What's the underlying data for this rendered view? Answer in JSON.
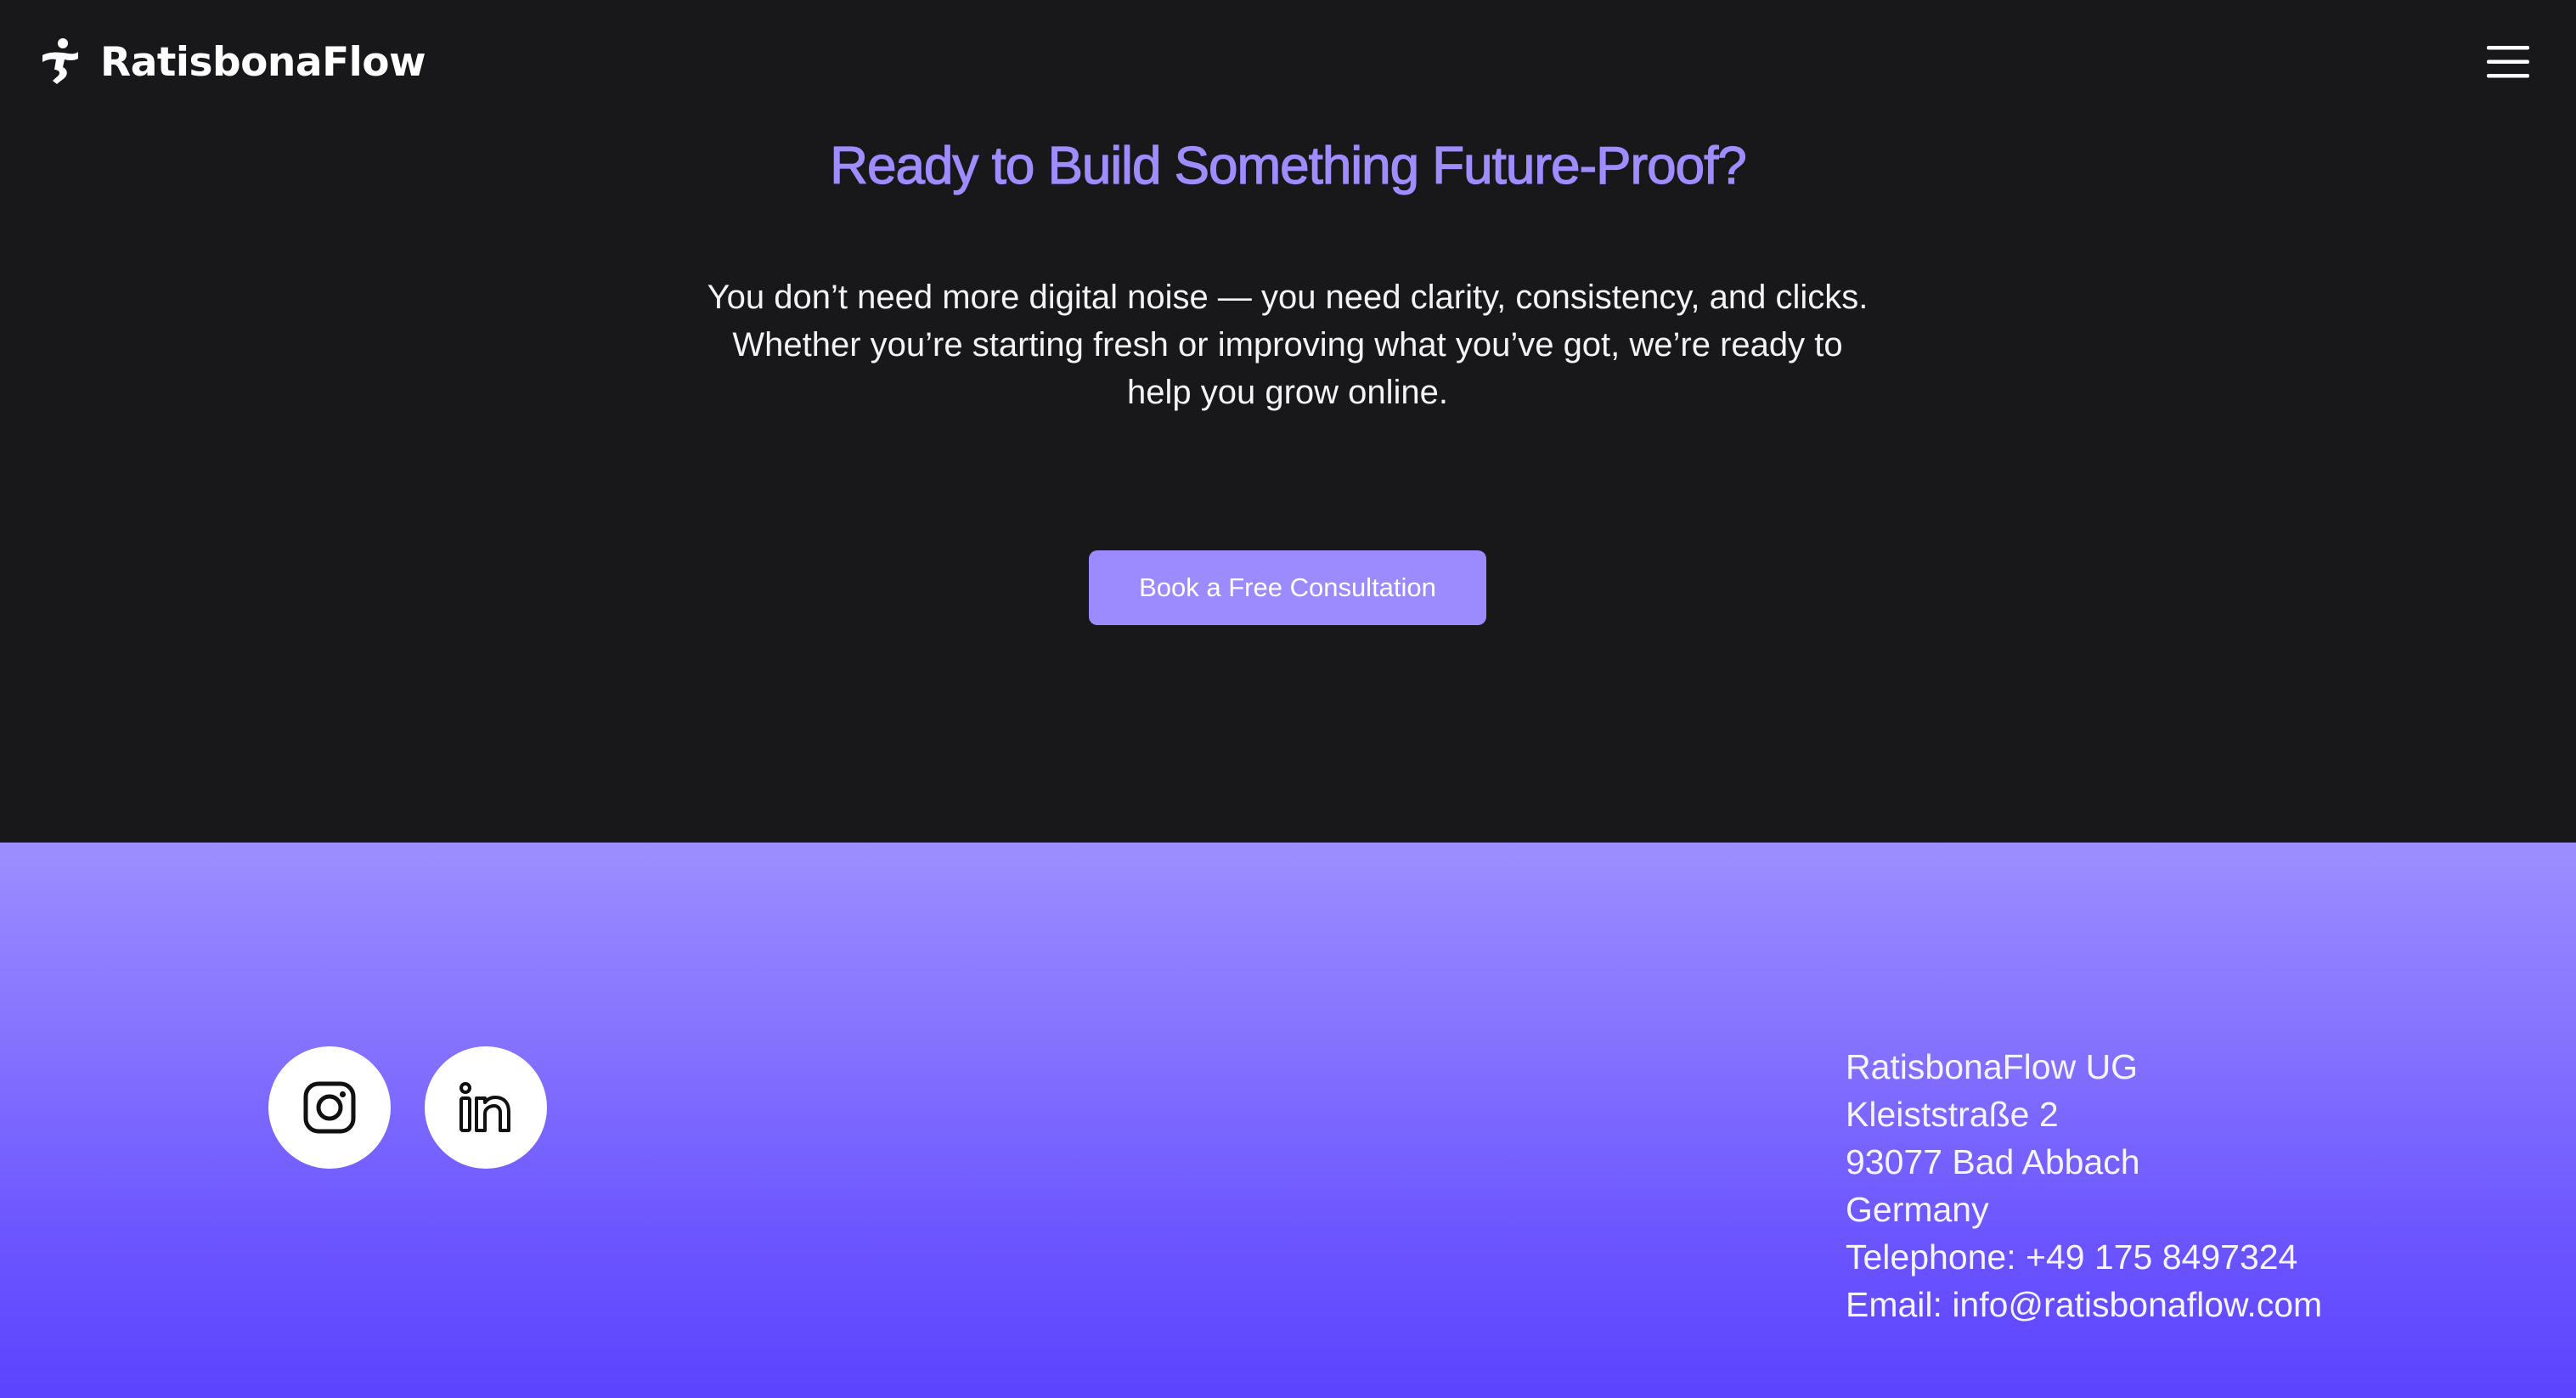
{
  "header": {
    "brand_name": "RatisbonaFlow",
    "logo_icon": "figure-flow-logo-icon",
    "menu_icon": "hamburger-menu-icon"
  },
  "cta": {
    "title": "Ready to Build Something Future-Proof?",
    "text_lines": [
      "You don’t need more digital noise — you need clarity, consistency, and clicks.",
      "Whether you’re starting fresh or improving what you’ve got, we’re ready to",
      "help you grow online."
    ],
    "button_label": "Book a Free Consultation"
  },
  "footer": {
    "socials": [
      {
        "name": "Instagram",
        "icon": "instagram-icon"
      },
      {
        "name": "LinkedIn",
        "icon": "linkedin-icon"
      }
    ],
    "address": {
      "company": "RatisbonaFlow UG",
      "street": "Kleiststraße 2",
      "city": "93077 Bad Abbach",
      "country": "Germany",
      "telephone": "Telephone: +49 175 8497324",
      "email_prefix": "Email: ",
      "email": "info@ratisbonaflow.com"
    }
  },
  "colors": {
    "page_background": "#18181b",
    "accent": "#a08cff",
    "button": "#9c8bff",
    "footer_gradient_top": "#9d8eff",
    "footer_gradient_bottom": "#5b43ff",
    "text_light": "#f3f3f5"
  }
}
